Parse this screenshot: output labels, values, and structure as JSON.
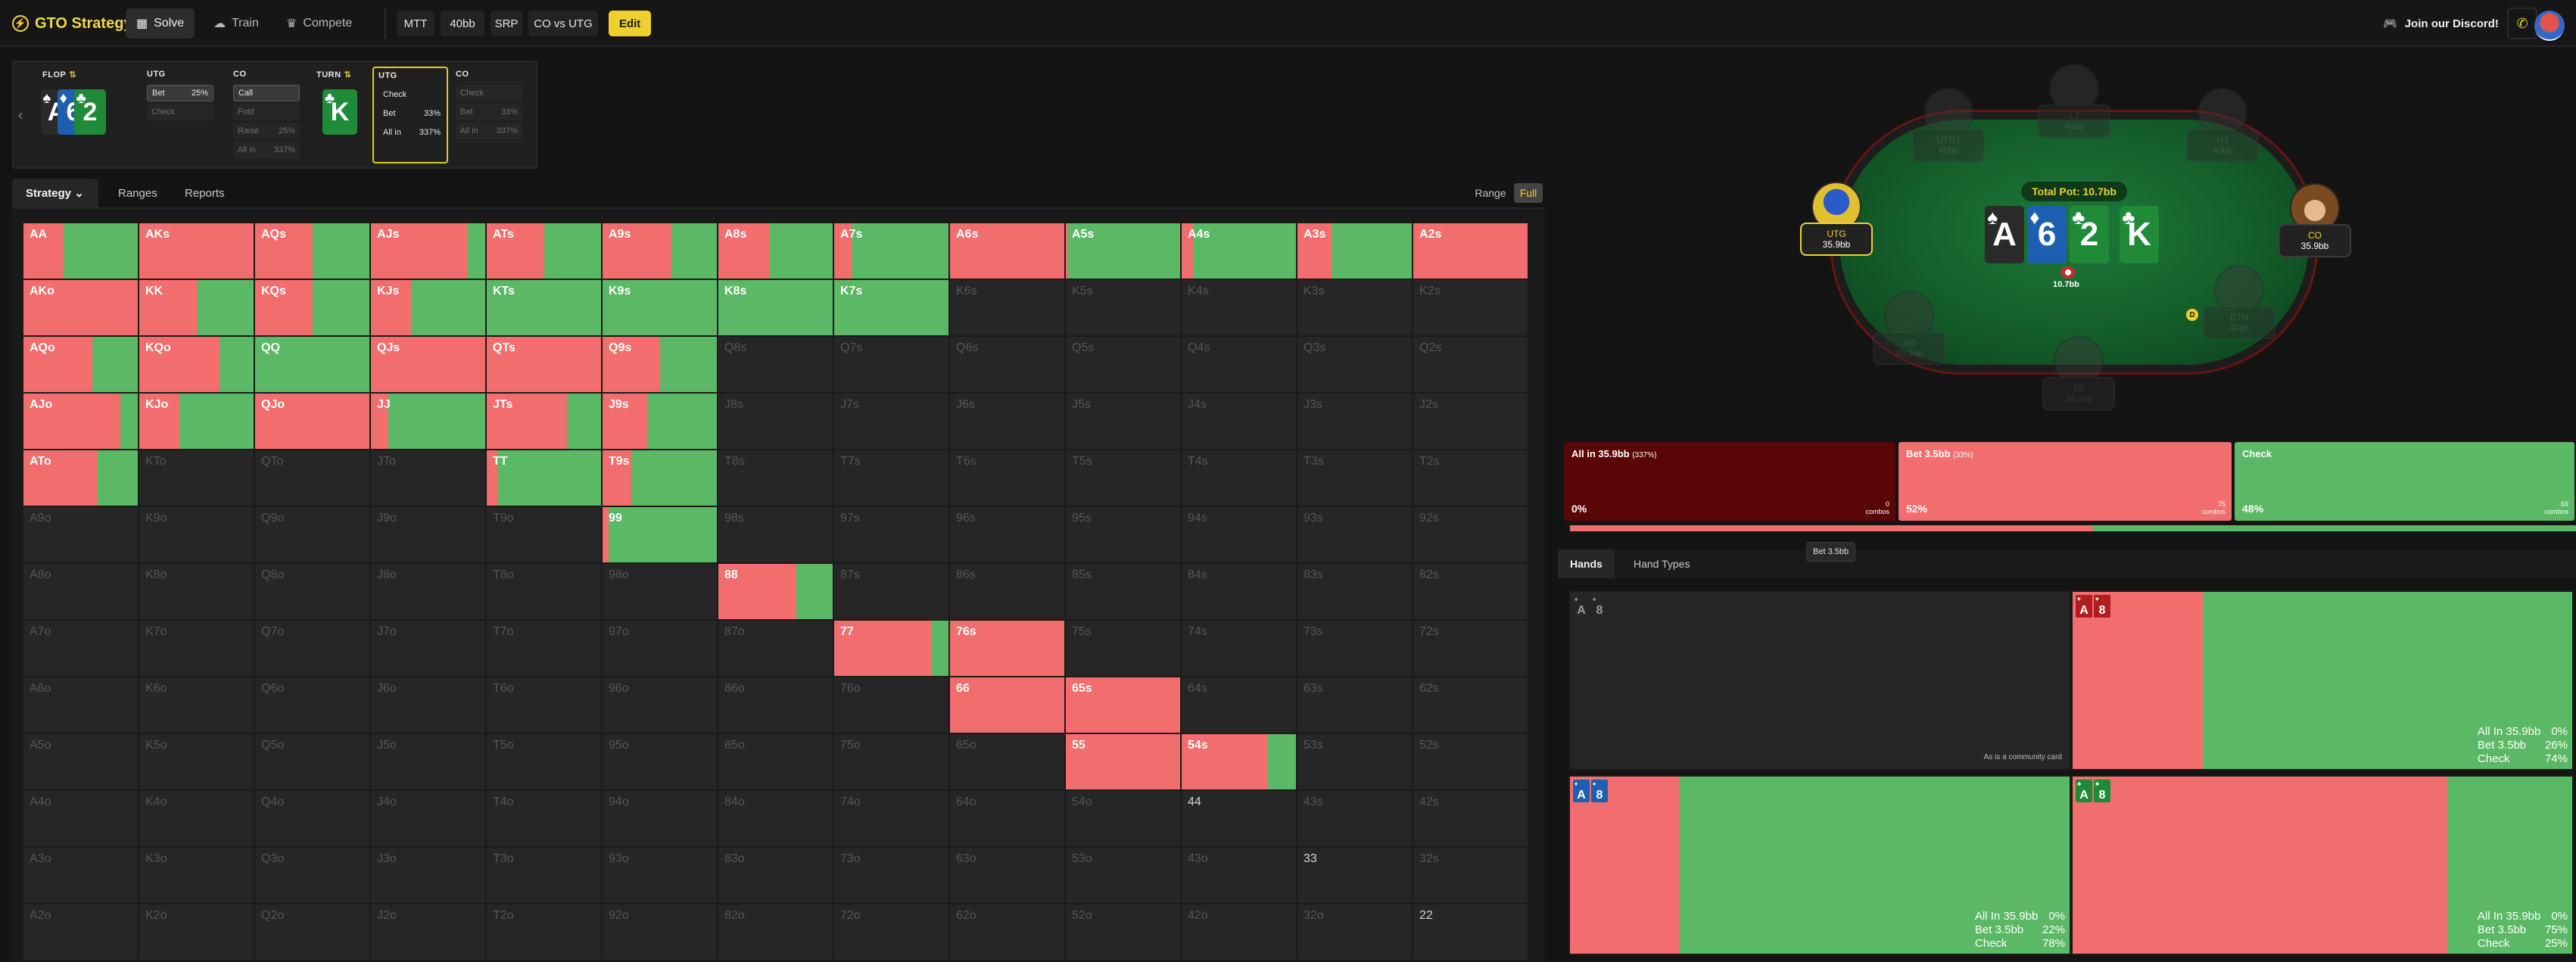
{
  "colors": {
    "allin": "#5a0607",
    "bet": "#f26d6d",
    "check": "#5bb865",
    "dim": "#262626",
    "accent": "#f0d030"
  },
  "topbar": {
    "brand": "GTO Strategy",
    "nav": [
      {
        "label": "Solve",
        "icon": "calculator-icon",
        "glyph": "▦"
      },
      {
        "label": "Train",
        "icon": "brain-icon",
        "glyph": "☁"
      },
      {
        "label": "Compete",
        "icon": "crown-icon",
        "glyph": "♛"
      }
    ],
    "chips": [
      "MTT",
      "40bb",
      "SRP",
      "CO vs UTG"
    ],
    "edit_label": "Edit",
    "discord_label": "Join our Discord!",
    "phone_icon": "phone-icon"
  },
  "history": {
    "flop_label": "FLOP",
    "turn_label": "TURN",
    "flop_cards": [
      {
        "rank": "A",
        "suit": "♠",
        "color": "spade"
      },
      {
        "rank": "6",
        "suit": "♦",
        "color": "diamond"
      },
      {
        "rank": "2",
        "suit": "♣",
        "color": "club"
      }
    ],
    "turn_card": {
      "rank": "K",
      "suit": "♣",
      "color": "club"
    },
    "cols": [
      {
        "name": "UTG",
        "actions": [
          {
            "label": "Bet",
            "val": "25%",
            "state": "sel"
          },
          {
            "label": "Check",
            "val": "",
            "state": "dim"
          }
        ]
      },
      {
        "name": "CO",
        "actions": [
          {
            "label": "Call",
            "val": "",
            "state": "sel"
          },
          {
            "label": "Fold",
            "val": "",
            "state": "dim"
          },
          {
            "label": "Raise",
            "val": "25%",
            "state": "dim"
          },
          {
            "label": "All in",
            "val": "337%",
            "state": "dim"
          }
        ]
      },
      {
        "name": "UTG",
        "actions": [
          {
            "label": "Check",
            "val": "",
            "state": "plain"
          },
          {
            "label": "Bet",
            "val": "33%",
            "state": "plain"
          },
          {
            "label": "All in",
            "val": "337%",
            "state": "plain"
          }
        ]
      },
      {
        "name": "CO",
        "actions": [
          {
            "label": "Check",
            "val": "",
            "state": "dim"
          },
          {
            "label": "Bet",
            "val": "33%",
            "state": "dim"
          },
          {
            "label": "All in",
            "val": "337%",
            "state": "dim"
          }
        ]
      }
    ]
  },
  "strategy_tabs": {
    "strategy": "Strategy",
    "ranges": "Ranges",
    "reports": "Reports",
    "range_toggle": "Range",
    "full_toggle": "Full"
  },
  "grid": {
    "ranks": [
      "A",
      "K",
      "Q",
      "J",
      "T",
      "9",
      "8",
      "7",
      "6",
      "5",
      "4",
      "3",
      "2"
    ],
    "active": {
      "AA": [
        0,
        0.35,
        0.65
      ],
      "AKs": [
        0,
        1,
        0
      ],
      "AQs": [
        0,
        0.5,
        0.5
      ],
      "AJs": [
        0,
        0.85,
        0.15
      ],
      "ATs": [
        0,
        0.5,
        0.5
      ],
      "A9s": [
        0,
        0.6,
        0.4
      ],
      "A8s": [
        0,
        0.45,
        0.55
      ],
      "A7s": [
        0,
        0.15,
        0.85
      ],
      "A6s": [
        0,
        1,
        0
      ],
      "A5s": [
        0,
        0.02,
        0.98
      ],
      "A4s": [
        0,
        0.1,
        0.9
      ],
      "A3s": [
        0,
        0.3,
        0.7
      ],
      "A2s": [
        0,
        1,
        0
      ],
      "AKo": [
        0,
        1,
        0
      ],
      "KK": [
        0,
        0.5,
        0.5
      ],
      "KQs": [
        0,
        0.5,
        0.5
      ],
      "KJs": [
        0,
        0.35,
        0.65
      ],
      "KTs": [
        0,
        0,
        1
      ],
      "K9s": [
        0,
        0,
        1
      ],
      "K8s": [
        0,
        0,
        1
      ],
      "K7s": [
        0,
        0,
        1
      ],
      "AQo": [
        0,
        0.6,
        0.4
      ],
      "KQo": [
        0,
        0.7,
        0.3
      ],
      "QQ": [
        0,
        0,
        1
      ],
      "QJs": [
        0,
        1,
        0
      ],
      "QTs": [
        0,
        1,
        0
      ],
      "Q9s": [
        0,
        0.5,
        0.5
      ],
      "AJo": [
        0,
        0.85,
        0.15
      ],
      "KJo": [
        0,
        0.35,
        0.65
      ],
      "QJo": [
        0,
        1,
        0
      ],
      "JJ": [
        0,
        0.15,
        0.85
      ],
      "JTs": [
        0,
        0.7,
        0.3
      ],
      "J9s": [
        0,
        0.4,
        0.6
      ],
      "ATo": [
        0,
        0.65,
        0.35
      ],
      "TT": [
        0,
        0.1,
        0.9
      ],
      "T9s": [
        0,
        0.25,
        0.75
      ],
      "99": [
        0,
        0.05,
        0.95
      ],
      "88": [
        0,
        0.68,
        0.32
      ],
      "77": [
        0,
        0.85,
        0.15
      ],
      "76s": [
        0,
        1,
        0
      ],
      "66": [
        0,
        1,
        0
      ],
      "65s": [
        0,
        1,
        0
      ],
      "55": [
        0,
        1,
        0
      ],
      "54s": [
        0,
        0.75,
        0.25
      ]
    },
    "pair_dead": [
      "44",
      "33",
      "22"
    ]
  },
  "table": {
    "total_pot": "Total Pot: 10.7bb",
    "board": [
      {
        "rank": "A",
        "suit": "♠",
        "color": "spade"
      },
      {
        "rank": "6",
        "suit": "♦",
        "color": "diamond"
      },
      {
        "rank": "2",
        "suit": "♣",
        "color": "club"
      },
      {
        "rank": "K",
        "suit": "♣",
        "color": "club"
      }
    ],
    "chips_label": "10.7bb",
    "dealer": "D",
    "seats": [
      {
        "name": "UTG",
        "stack": "35.9bb",
        "state": "active"
      },
      {
        "name": "CO",
        "stack": "35.9bb",
        "state": "live"
      },
      {
        "name": "UTG1",
        "stack": "40bb",
        "state": "faded"
      },
      {
        "name": "LJ",
        "stack": "40bb",
        "state": "faded"
      },
      {
        "name": "HJ",
        "stack": "40bb",
        "state": "faded"
      },
      {
        "name": "BTN",
        "stack": "40bb",
        "state": "faded"
      },
      {
        "name": "SB",
        "stack": "39.5bb",
        "state": "faded"
      },
      {
        "name": "BB",
        "stack": "39.5bb",
        "state": "faded"
      }
    ]
  },
  "actions": [
    {
      "title": "All in 35.9bb",
      "pct_label": "(337%)",
      "freq": "0%",
      "combos_n": "0",
      "combos_label": "combos",
      "key": "allin"
    },
    {
      "title": "Bet 3.5bb",
      "pct_label": "(33%)",
      "freq": "52%",
      "combos_n": "75",
      "combos_label": "combos",
      "key": "bet"
    },
    {
      "title": "Check",
      "pct_label": "",
      "freq": "48%",
      "combos_n": "69",
      "combos_label": "combos",
      "key": "check"
    }
  ],
  "freq_split": [
    0.0,
    0.52,
    0.48
  ],
  "tooltip": "Bet 3.5bb",
  "hands_tabs": {
    "hands": "Hands",
    "hand_types": "Hand Types"
  },
  "combos": [
    {
      "suit_a": "♠",
      "suit_8": "♠",
      "color": "spade",
      "note": "As is a community card",
      "split": [
        0,
        0,
        0
      ],
      "stats": []
    },
    {
      "suit_a": "♥",
      "suit_8": "♥",
      "color": "heart",
      "note": "",
      "split": [
        0,
        0.26,
        0.74
      ],
      "stats": [
        [
          "All In 35.9bb",
          "0%"
        ],
        [
          "Bet 3.5bb",
          "26%"
        ],
        [
          "Check",
          "74%"
        ]
      ]
    },
    {
      "suit_a": "♦",
      "suit_8": "♦",
      "color": "diamond",
      "note": "",
      "split": [
        0,
        0.22,
        0.78
      ],
      "stats": [
        [
          "All In 35.9bb",
          "0%"
        ],
        [
          "Bet 3.5bb",
          "22%"
        ],
        [
          "Check",
          "78%"
        ]
      ]
    },
    {
      "suit_a": "♣",
      "suit_8": "♣",
      "color": "club",
      "note": "",
      "split": [
        0,
        0.75,
        0.25
      ],
      "stats": [
        [
          "All In 35.9bb",
          "0%"
        ],
        [
          "Bet 3.5bb",
          "75%"
        ],
        [
          "Check",
          "25%"
        ]
      ]
    }
  ]
}
